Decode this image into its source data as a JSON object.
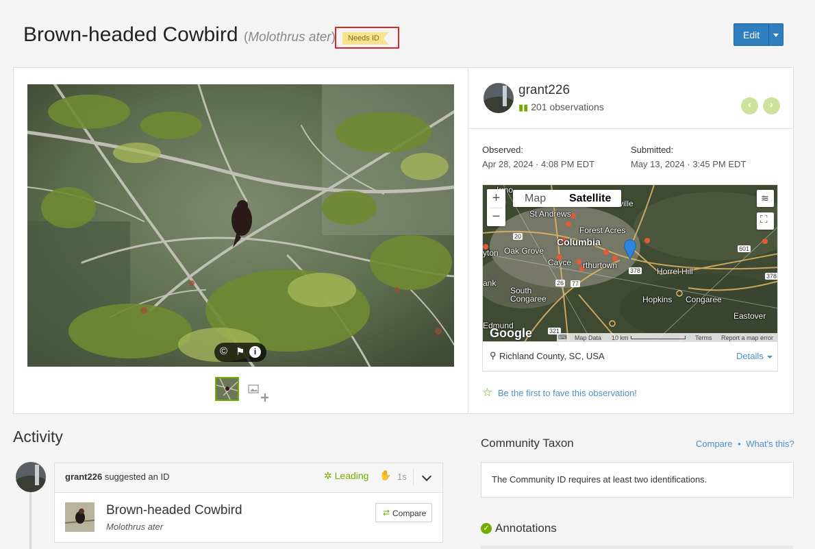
{
  "header": {
    "common_name": "Brown-headed Cowbird",
    "paren_open": "(",
    "scientific_name": "Molothrus ater",
    "paren_close": ")",
    "badge": "Needs ID",
    "edit_label": "Edit"
  },
  "observer": {
    "username": "grant226",
    "observations": "201 observations"
  },
  "dates": {
    "observed_label": "Observed:",
    "observed_value": "Apr 28, 2024 · 4:08 PM EDT",
    "submitted_label": "Submitted:",
    "submitted_value": "May 13, 2024 · 3:45 PM EDT"
  },
  "map": {
    "tab_map": "Map",
    "tab_satellite": "Satellite",
    "zoom_in": "+",
    "zoom_out": "−",
    "labels": [
      "St Andrews",
      "Forest Acres",
      "Columbia",
      "Oak Grove",
      "Cayce",
      "rthurtown",
      "Horrel Hill",
      "South Congaree",
      "Hopkins",
      "Congaree",
      "Eastover",
      "Edmund",
      "ank",
      "yton",
      "ville",
      "Irmo"
    ],
    "shields": [
      "20",
      "26",
      "77",
      "378",
      "601",
      "378",
      "321"
    ],
    "logo": "Google",
    "footer": {
      "map_data": "Map Data",
      "scale": "10 km",
      "terms": "Terms",
      "report": "Report a map error"
    }
  },
  "location": {
    "place": "Richland County, SC, USA",
    "details": "Details"
  },
  "fave_text": "Be the first to fave this observation!",
  "activity": {
    "heading": "Activity",
    "user": "grant226",
    "action": " suggested an ID",
    "leading": "Leading",
    "time": "1s",
    "taxon_common": "Brown-headed Cowbird",
    "taxon_scientific": "Molothrus ater",
    "compare": "Compare"
  },
  "community": {
    "heading": "Community Taxon",
    "compare": "Compare",
    "dot": "•",
    "whats_this": "What's this?",
    "message": "The Community ID requires at least two identifications."
  },
  "annotations": {
    "heading": "Annotations"
  },
  "colors": {
    "accent_green": "#74ac00",
    "link_blue": "#4d8fc8",
    "button_blue": "#2f7ebd",
    "badge_yellow": "#f8e38a"
  }
}
